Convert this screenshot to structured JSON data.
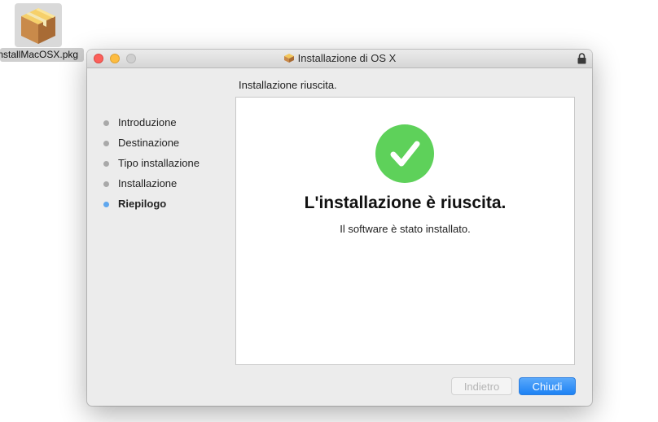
{
  "desktop": {
    "file_label": "InstallMacOSX.pkg"
  },
  "window": {
    "title": "Installazione di OS X",
    "subtitle": "Installazione riuscita."
  },
  "sidebar": {
    "steps": [
      {
        "label": "Introduzione",
        "active": false
      },
      {
        "label": "Destinazione",
        "active": false
      },
      {
        "label": "Tipo installazione",
        "active": false
      },
      {
        "label": "Installazione",
        "active": false
      },
      {
        "label": "Riepilogo",
        "active": true
      }
    ]
  },
  "content": {
    "headline": "L'installazione è riuscita.",
    "message": "Il software è stato installato."
  },
  "buttons": {
    "back_label": "Indietro",
    "close_label": "Chiudi"
  },
  "icons": {
    "package": "package-icon",
    "lock": "lock-icon",
    "success": "success-checkmark-icon"
  },
  "colors": {
    "success_green": "#5ed15a",
    "active_step_dot": "#5fa7ee",
    "primary_button": "#1d82f4",
    "traffic_close": "#fc605b",
    "traffic_minimize": "#fdbc40"
  }
}
